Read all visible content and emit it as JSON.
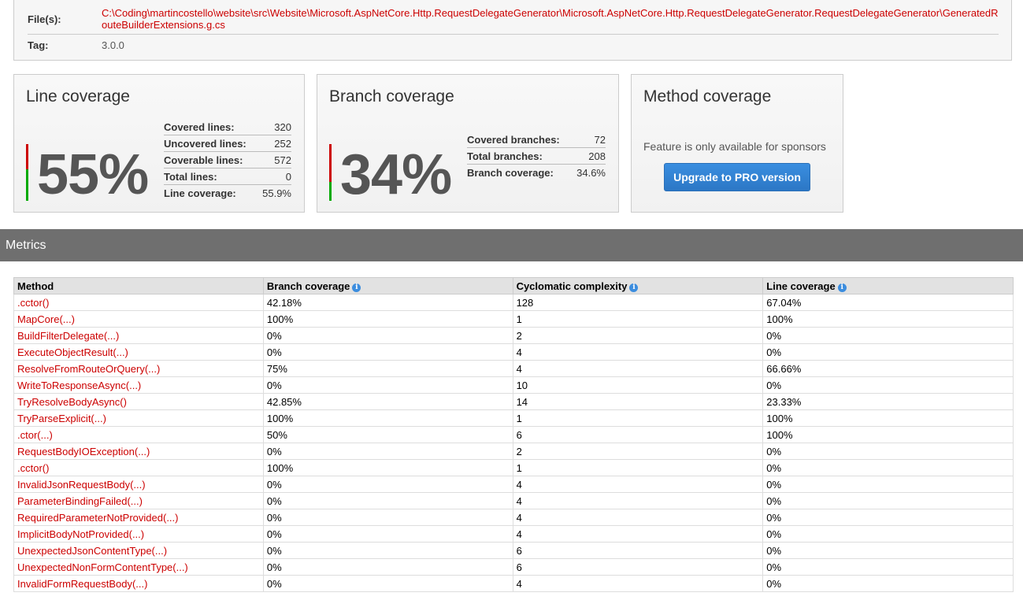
{
  "info": {
    "files_label": "File(s):",
    "files_value": "C:\\Coding\\martincostello\\website\\src\\Website\\Microsoft.AspNetCore.Http.RequestDelegateGenerator\\Microsoft.AspNetCore.Http.RequestDelegateGenerator.RequestDelegateGenerator\\GeneratedRouteBuilderExtensions.g.cs",
    "tag_label": "Tag:",
    "tag_value": "3.0.0"
  },
  "line_coverage": {
    "title": "Line coverage",
    "percent": "55%",
    "percent_value": 55,
    "stats": [
      {
        "label": "Covered lines:",
        "value": "320"
      },
      {
        "label": "Uncovered lines:",
        "value": "252"
      },
      {
        "label": "Coverable lines:",
        "value": "572"
      },
      {
        "label": "Total lines:",
        "value": "0"
      },
      {
        "label": "Line coverage:",
        "value": "55.9%"
      }
    ]
  },
  "branch_coverage": {
    "title": "Branch coverage",
    "percent": "34%",
    "percent_value": 34,
    "stats": [
      {
        "label": "Covered branches:",
        "value": "72"
      },
      {
        "label": "Total branches:",
        "value": "208"
      },
      {
        "label": "Branch coverage:",
        "value": "34.6%"
      }
    ]
  },
  "method_coverage": {
    "title": "Method coverage",
    "message": "Feature is only available for sponsors",
    "button_label": "Upgrade to PRO version"
  },
  "metrics": {
    "title": "Metrics",
    "columns": [
      "Method",
      "Branch coverage",
      "Cyclomatic complexity",
      "Line coverage"
    ],
    "rows": [
      [
        ".cctor()",
        "42.18%",
        "128",
        "67.04%"
      ],
      [
        "MapCore(...)",
        "100%",
        "1",
        "100%"
      ],
      [
        "BuildFilterDelegate(...)",
        "0%",
        "2",
        "0%"
      ],
      [
        "ExecuteObjectResult(...)",
        "0%",
        "4",
        "0%"
      ],
      [
        "ResolveFromRouteOrQuery(...)",
        "75%",
        "4",
        "66.66%"
      ],
      [
        "WriteToResponseAsync(...)",
        "0%",
        "10",
        "0%"
      ],
      [
        "TryResolveBodyAsync()",
        "42.85%",
        "14",
        "23.33%"
      ],
      [
        "TryParseExplicit(...)",
        "100%",
        "1",
        "100%"
      ],
      [
        ".ctor(...)",
        "50%",
        "6",
        "100%"
      ],
      [
        "RequestBodyIOException(...)",
        "0%",
        "2",
        "0%"
      ],
      [
        ".cctor()",
        "100%",
        "1",
        "0%"
      ],
      [
        "InvalidJsonRequestBody(...)",
        "0%",
        "4",
        "0%"
      ],
      [
        "ParameterBindingFailed(...)",
        "0%",
        "4",
        "0%"
      ],
      [
        "RequiredParameterNotProvided(...)",
        "0%",
        "4",
        "0%"
      ],
      [
        "ImplicitBodyNotProvided(...)",
        "0%",
        "4",
        "0%"
      ],
      [
        "UnexpectedJsonContentType(...)",
        "0%",
        "6",
        "0%"
      ],
      [
        "UnexpectedNonFormContentType(...)",
        "0%",
        "6",
        "0%"
      ],
      [
        "InvalidFormRequestBody(...)",
        "0%",
        "4",
        "0%"
      ]
    ]
  }
}
